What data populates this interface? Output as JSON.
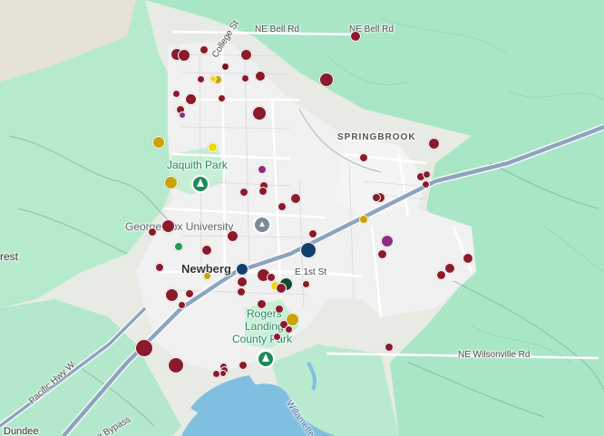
{
  "map": {
    "labels": {
      "ne_bell_rd_left": "NE Bell Rd",
      "ne_bell_rd_right": "NE Bell Rd",
      "college_st": "College St",
      "springbrook": "SPRINGBROOK",
      "jaquith_park": "Jaquith Park",
      "george_fox": "George Fox University",
      "newberg": "Newberg",
      "e_1st_st": "E 1st St",
      "rogers_landing_1": "Rogers",
      "rogers_landing_2": "Landing",
      "rogers_landing_3": "County Park",
      "ne_wilsonville_rd": "NE Wilsonville Rd",
      "pacific_hwy": "Pacific Hwy W",
      "bypass": "e Bypass",
      "willamette": "Willamette",
      "forest": "rest",
      "dundee": "Dundee"
    },
    "icons": {
      "park": "tree-icon",
      "university": "graduation-cap-icon"
    },
    "colors": {
      "dark_red": "#8b1a2b",
      "maroon": "#7a1020",
      "gold": "#c9a400",
      "yellow": "#f2d600",
      "navy": "#123f6e",
      "purple": "#8e2b87",
      "green": "#1e9c52",
      "dark_green": "#0d4d2a",
      "forest": "#a8e6c5",
      "urban": "#f1f1f1",
      "water": "#80bfe0",
      "highway": "#8ea4be"
    }
  }
}
